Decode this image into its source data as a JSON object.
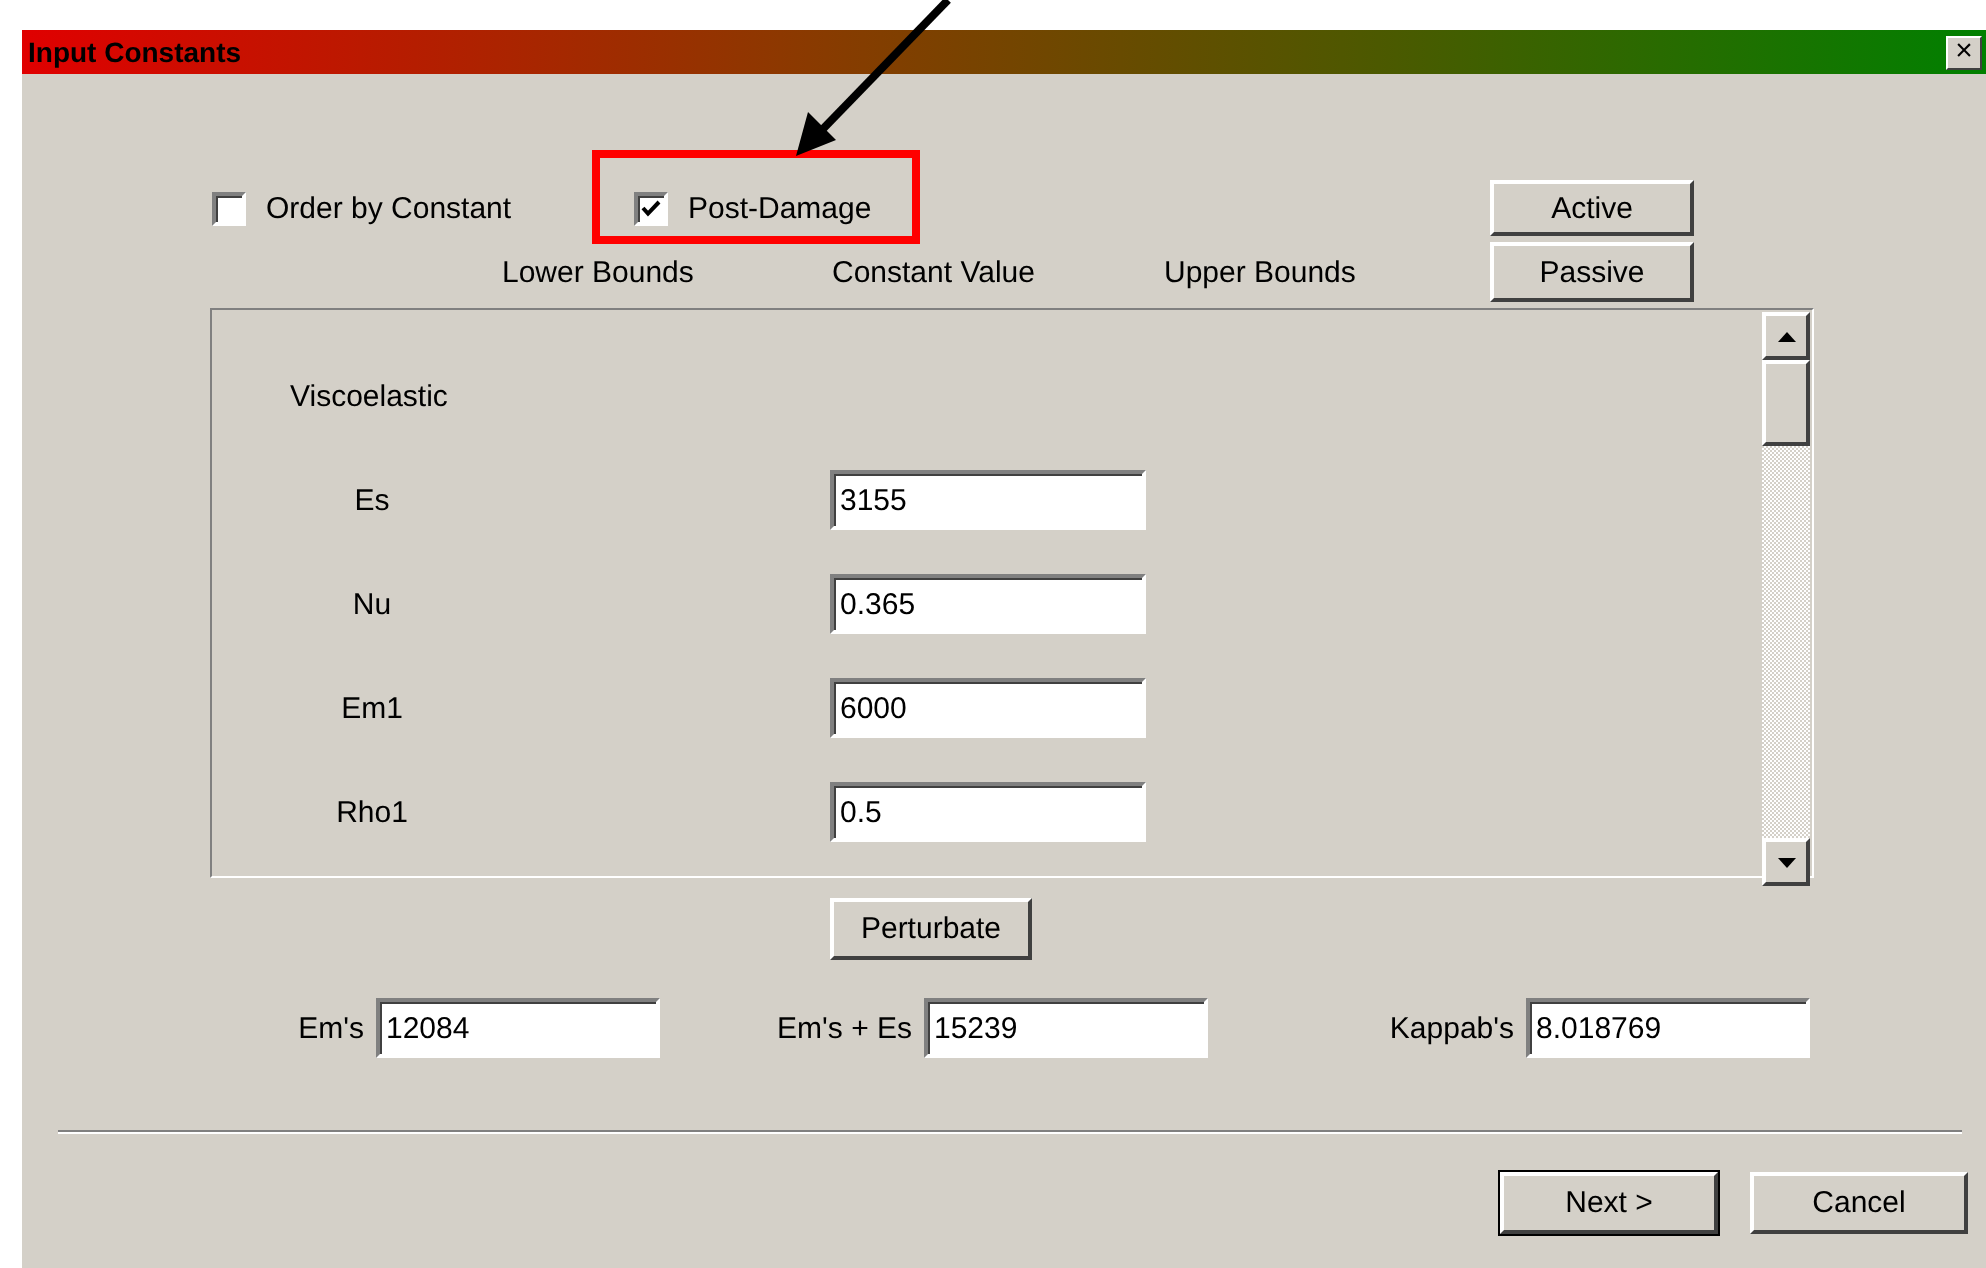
{
  "window": {
    "title": "Input Constants",
    "close": "×"
  },
  "options": [
    {
      "label": "Order by Constant",
      "checked": false
    },
    {
      "label": "Post-Damage",
      "checked": true
    }
  ],
  "mode_buttons": [
    "Active",
    "Passive"
  ],
  "column_headers": [
    "Lower Bounds",
    "Constant Value",
    "Upper Bounds"
  ],
  "section": "Viscoelastic",
  "constants": [
    {
      "name": "Es",
      "value": "3155"
    },
    {
      "name": "Nu",
      "value": "0.365"
    },
    {
      "name": "Em1",
      "value": "6000"
    },
    {
      "name": "Rho1",
      "value": "0.5"
    }
  ],
  "perturbate_button": "Perturbate",
  "results": [
    {
      "label": "Em's",
      "value": "12084"
    },
    {
      "label": "Em's + Es",
      "value": "15239"
    },
    {
      "label": "Kappab's",
      "value": "8.018769"
    }
  ],
  "buttons": [
    "Next >",
    "Cancel"
  ]
}
